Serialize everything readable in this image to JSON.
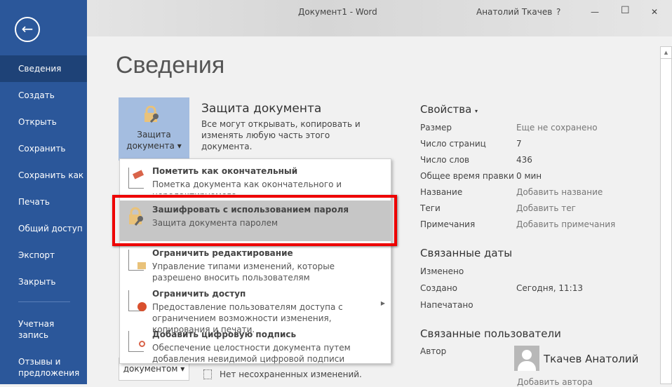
{
  "window": {
    "title": "Документ1 - Word",
    "user": "Анатолий Ткачев",
    "help": "?",
    "minimize": "—",
    "maximize": "☐",
    "close": "✕"
  },
  "sidebar": {
    "back": "←",
    "items": [
      "Сведения",
      "Создать",
      "Открыть",
      "Сохранить",
      "Сохранить как",
      "Печать",
      "Общий доступ",
      "Экспорт",
      "Закрыть"
    ],
    "account": "Учетная запись",
    "feedback": "Отзывы и предложения"
  },
  "page": {
    "title": "Сведения"
  },
  "protect": {
    "button_line1": "Защита",
    "button_line2": "документа",
    "heading": "Защита документа",
    "description": "Все могут открывать, копировать и изменять любую часть этого документа."
  },
  "menu": [
    {
      "title": "Пометить как окончательный",
      "desc": "Пометка документа как окончательного и нередактируемого"
    },
    {
      "title": "Зашифровать с использованием пароля",
      "desc": "Защита документа паролем"
    },
    {
      "title": "Ограничить редактирование",
      "desc": "Управление типами изменений, которые разрешено вносить пользователям"
    },
    {
      "title": "Ограничить доступ",
      "desc": "Предоставление пользователям доступа с ограничением возможности изменения, копирования и печати."
    },
    {
      "title": "Добавить цифровую подпись",
      "desc": "Обеспечение целостности документа путем добавления невидимой цифровой подписи"
    }
  ],
  "manage": {
    "button": "документом",
    "status": "Нет несохраненных изменений."
  },
  "properties": {
    "heading": "Свойства",
    "rows": [
      {
        "label": "Размер",
        "value": "Еще не сохранено"
      },
      {
        "label": "Число страниц",
        "value": "7"
      },
      {
        "label": "Число слов",
        "value": "436"
      },
      {
        "label": "Общее время правки",
        "value": "0 мин"
      },
      {
        "label": "Название",
        "value": "Добавить название"
      },
      {
        "label": "Теги",
        "value": "Добавить тег"
      },
      {
        "label": "Примечания",
        "value": "Добавить примечания"
      }
    ]
  },
  "dates": {
    "heading": "Связанные даты",
    "rows": [
      {
        "label": "Изменено",
        "value": ""
      },
      {
        "label": "Создано",
        "value": "Сегодня, 11:13"
      },
      {
        "label": "Напечатано",
        "value": ""
      }
    ]
  },
  "people": {
    "heading": "Связанные пользователи",
    "author_label": "Автор",
    "author": "Ткачев Анатолий",
    "add_author": "Добавить автора"
  }
}
